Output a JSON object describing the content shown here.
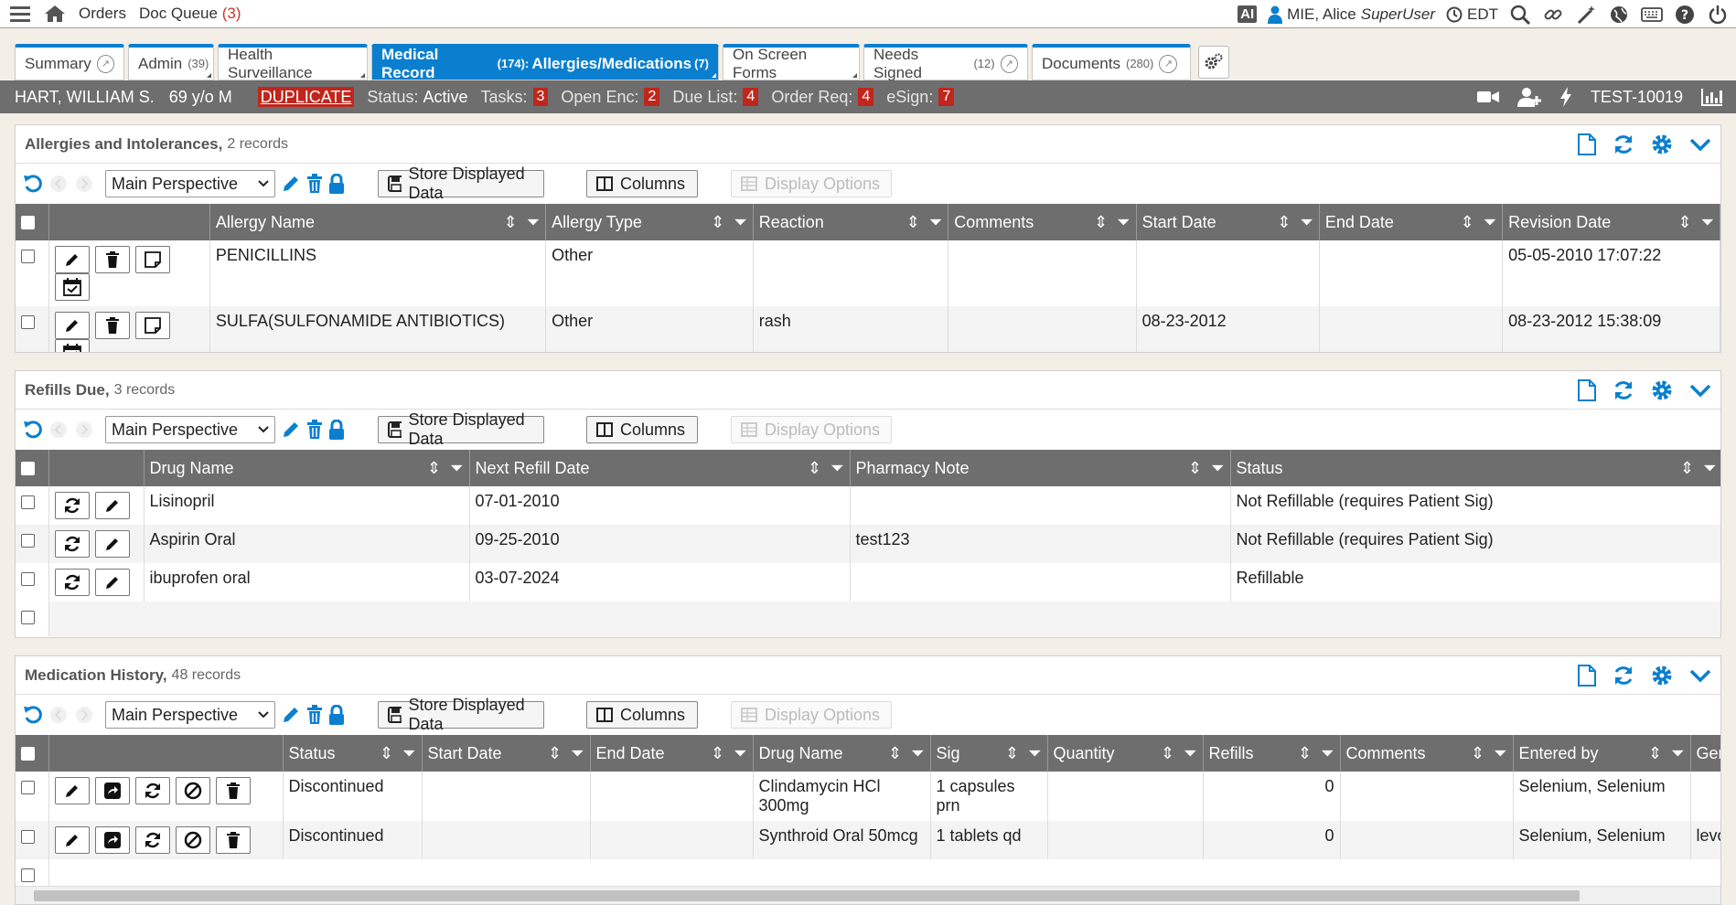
{
  "topbar": {
    "orders": "Orders",
    "doc_queue": "Doc Queue",
    "doc_queue_count": "(3)",
    "ai": "AI",
    "user": "MIE, Alice",
    "role": "SuperUser",
    "timezone": "EDT"
  },
  "tabs": [
    {
      "label": "Summary",
      "count": ""
    },
    {
      "label": "Admin",
      "count": "(39)"
    },
    {
      "label": "Health Surveillance",
      "count": ""
    },
    {
      "label": "Medical Record",
      "count": "(174):",
      "extra": "Allergies/Medications",
      "extra_count": "(7)"
    },
    {
      "label": "On Screen Forms",
      "count": ""
    },
    {
      "label": "Needs Signed",
      "count": "(12)"
    },
    {
      "label": "Documents",
      "count": "(280)"
    }
  ],
  "patient": {
    "name": "HART, WILLIAM S.",
    "age_sex": "69 y/o M",
    "duplicate": "DUPLICATE",
    "status_label": "Status:",
    "status": "Active",
    "tasks_label": "Tasks:",
    "tasks": "3",
    "open_enc_label": "Open Enc:",
    "open_enc": "2",
    "due_list_label": "Due List:",
    "due_list": "4",
    "order_req_label": "Order Req:",
    "order_req": "4",
    "esign_label": "eSign:",
    "esign": "7",
    "id": "TEST-10019"
  },
  "toolbar": {
    "perspective": "Main Perspective",
    "store": "Store Displayed Data",
    "columns": "Columns",
    "display_options": "Display Options"
  },
  "allergies": {
    "title": "Allergies and Intolerances,",
    "count": "2 records",
    "headers": [
      "Allergy Name",
      "Allergy Type",
      "Reaction",
      "Comments",
      "Start Date",
      "End Date",
      "Revision Date"
    ],
    "rows": [
      {
        "name": "PENICILLINS",
        "type": "Other",
        "reaction": "",
        "comments": "",
        "start": "",
        "end": "",
        "revision": "05-05-2010 17:07:22"
      },
      {
        "name": "SULFA(SULFONAMIDE ANTIBIOTICS)",
        "type": "Other",
        "reaction": "rash",
        "comments": "",
        "start": "08-23-2012",
        "end": "",
        "revision": "08-23-2012 15:38:09"
      }
    ]
  },
  "refills": {
    "title": "Refills Due,",
    "count": "3 records",
    "headers": [
      "Drug Name",
      "Next Refill Date",
      "Pharmacy Note",
      "Status"
    ],
    "rows": [
      {
        "drug": "Lisinopril",
        "next": "07-01-2010",
        "note": "",
        "status": "Not Refillable (requires Patient Sig)"
      },
      {
        "drug": "Aspirin Oral",
        "next": "09-25-2010",
        "note": "test123",
        "status": "Not Refillable (requires Patient Sig)"
      },
      {
        "drug": "ibuprofen oral",
        "next": "03-07-2024",
        "note": "",
        "status": "Refillable"
      }
    ]
  },
  "medhistory": {
    "title": "Medication History,",
    "count": "48 records",
    "headers": [
      "Status",
      "Start Date",
      "End Date",
      "Drug Name",
      "Sig",
      "Quantity",
      "Refills",
      "Comments",
      "Entered by",
      "Gener"
    ],
    "rows": [
      {
        "status": "Discontinued",
        "start": "",
        "end": "",
        "drug": "Clindamycin HCl 300mg",
        "sig": "1 capsules prn",
        "qty": "",
        "refills": "0",
        "comments": "",
        "entered": "Selenium, Selenium",
        "generic": ""
      },
      {
        "status": "Discontinued",
        "start": "",
        "end": "",
        "drug": "Synthroid Oral 50mcg",
        "sig": "1 tablets qd",
        "qty": "",
        "refills": "0",
        "comments": "",
        "entered": "Selenium, Selenium",
        "generic": "levoth"
      }
    ]
  },
  "colors": {
    "accent": "#0a7fcf",
    "header_gray": "#6e6e6e",
    "badge_red": "#c0261c"
  }
}
